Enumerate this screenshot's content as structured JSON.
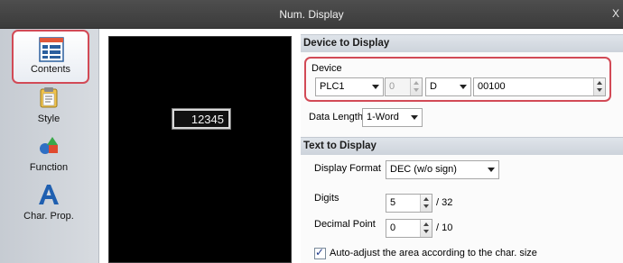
{
  "window": {
    "title": "Num. Display",
    "close_glyph": "X"
  },
  "sidebar": {
    "items": [
      {
        "label": "Contents",
        "icon": "contents-icon",
        "active": true
      },
      {
        "label": "Style",
        "icon": "style-icon"
      },
      {
        "label": "Function",
        "icon": "function-icon"
      },
      {
        "label": "Char. Prop.",
        "icon": "char-prop-icon"
      }
    ]
  },
  "preview": {
    "display_value": "12345"
  },
  "device_section": {
    "header": "Device to Display",
    "device_label": "Device",
    "plc": "PLC1",
    "station": "0",
    "device_type": "D",
    "address": "00100",
    "data_length_label": "Data Length",
    "data_length": "1-Word"
  },
  "text_section": {
    "header": "Text to Display",
    "display_format_label": "Display Format",
    "display_format": "DEC (w/o sign)",
    "digits_label": "Digits",
    "digits": "5",
    "digits_max": "/ 32",
    "decimal_label": "Decimal Point",
    "decimal": "0",
    "decimal_max": "/ 10",
    "auto_adjust_label": "Auto-adjust the area according to the char. size",
    "auto_adjust_checked": true
  },
  "colors": {
    "highlight": "#d24a56",
    "titlebar": "#454545",
    "section_header": "#d5dae1"
  }
}
